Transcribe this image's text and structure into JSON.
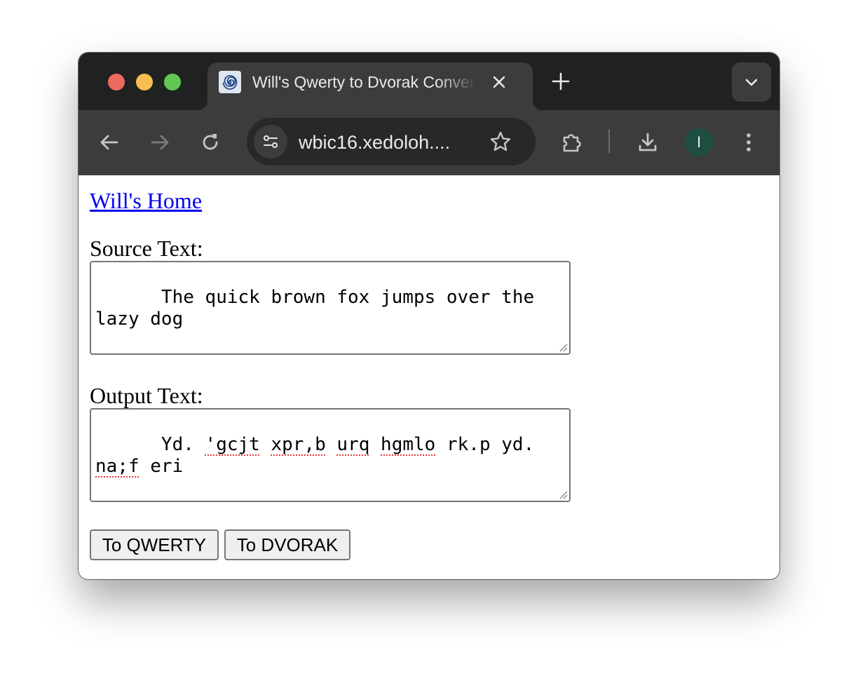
{
  "browser": {
    "tab": {
      "title": "Will's Qwerty to Dvorak Converter",
      "favicon": "swirl-icon"
    },
    "address_bar": {
      "url": "wbic16.xedoloh...."
    },
    "profile": {
      "initial": "I",
      "color": "#1e4e42"
    }
  },
  "page": {
    "home_link": "Will's Home",
    "source_label": "Source Text:",
    "source_value": "The quick brown fox jumps over the lazy dog",
    "output_label": "Output Text:",
    "output_words": [
      "Yd.",
      "'gcjt",
      "xpr,b",
      "urq",
      "hgmlo",
      "rk.p",
      "yd.",
      "na;f",
      "eri"
    ],
    "misspelled_words": [
      "'gcjt",
      "xpr,b",
      "urq",
      "hgmlo",
      "na;f"
    ],
    "buttons": {
      "to_qwerty": "To QWERTY",
      "to_dvorak": "To DVORAK"
    }
  },
  "colors": {
    "link": "#0000ee",
    "tabstrip": "#202221",
    "toolbar": "#3c3c3c",
    "spellcheck": "#e53935"
  }
}
